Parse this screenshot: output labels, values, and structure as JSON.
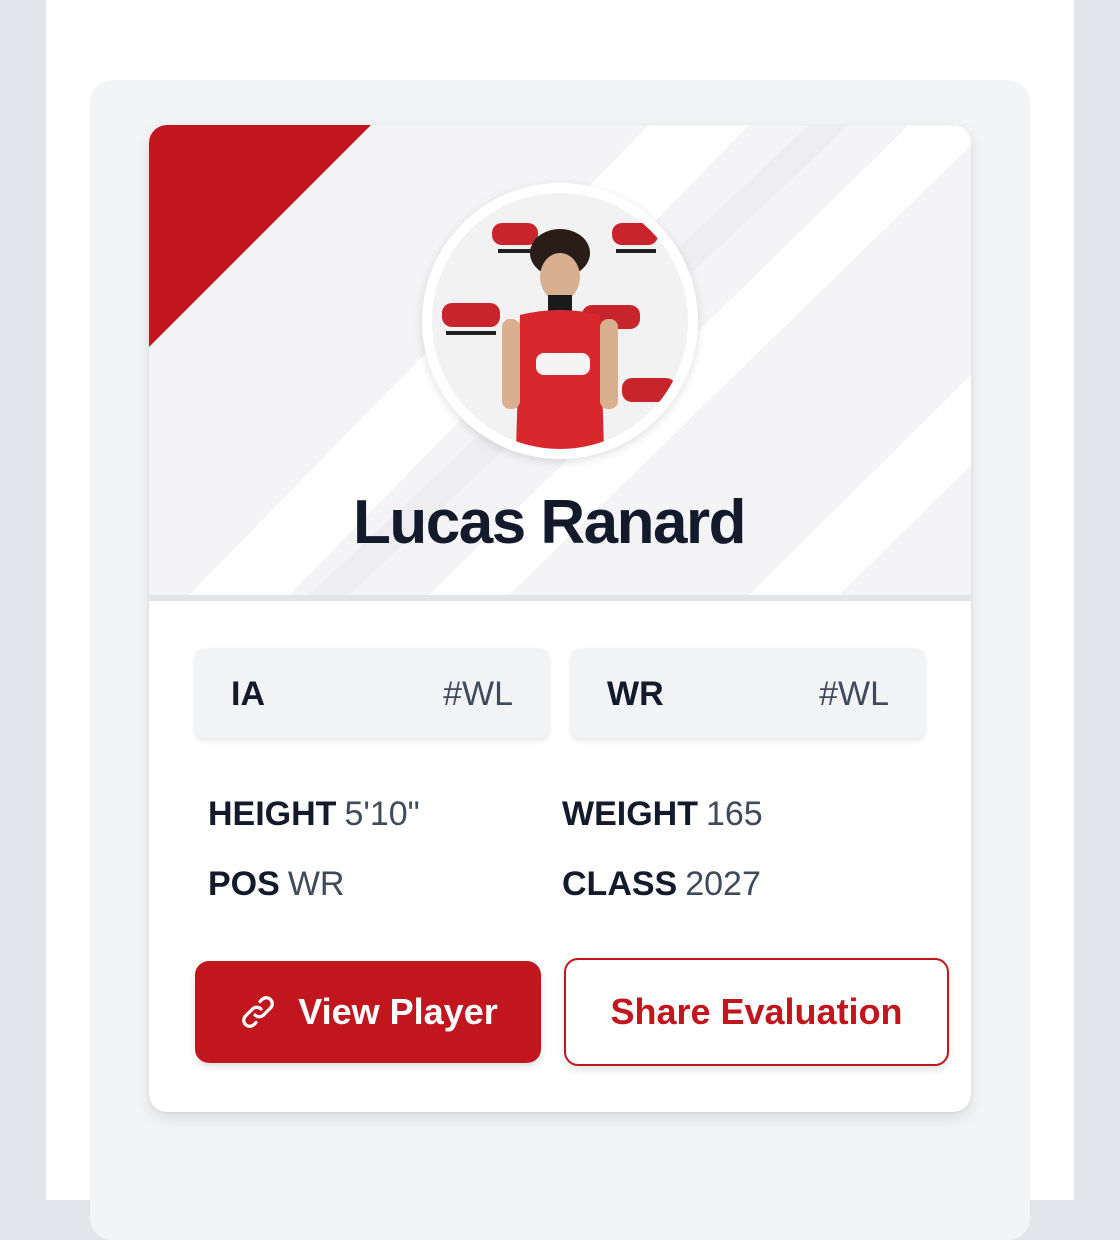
{
  "player": {
    "name": "Lucas Ranard",
    "photo_description_icon": "player-photo"
  },
  "rankings": [
    {
      "label": "IA",
      "value": "#WL"
    },
    {
      "label": "WR",
      "value": "#WL"
    }
  ],
  "stats": {
    "height": {
      "label": "HEIGHT",
      "value": "5'10\""
    },
    "weight": {
      "label": "WEIGHT",
      "value": "165"
    },
    "pos": {
      "label": "POS",
      "value": "WR"
    },
    "class": {
      "label": "CLASS",
      "value": "2027"
    }
  },
  "actions": {
    "view_label": "View Player",
    "share_label": "Share Evaluation"
  },
  "colors": {
    "accent": "#c1161d",
    "text_dark": "#121a2b",
    "text_muted": "#3f4a5c"
  }
}
